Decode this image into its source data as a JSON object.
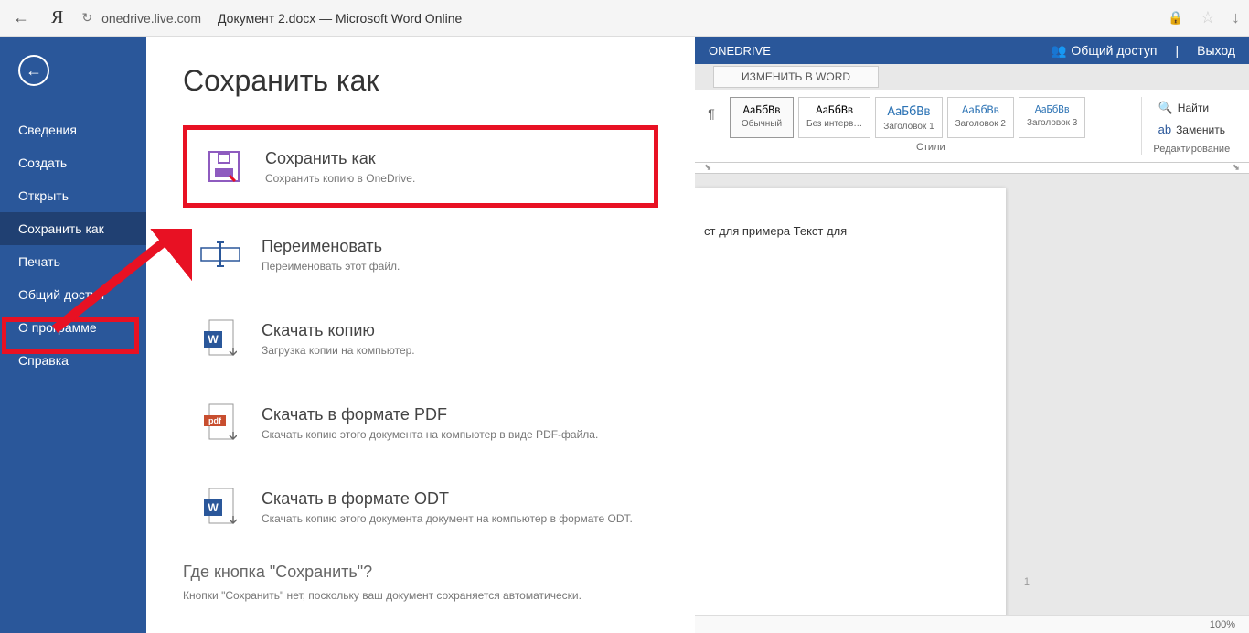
{
  "browser": {
    "url": "onedrive.live.com",
    "title": "Документ 2.docx — Microsoft Word Online"
  },
  "backstage": {
    "title": "Сохранить как",
    "menu": [
      {
        "label": "Сведения"
      },
      {
        "label": "Создать"
      },
      {
        "label": "Открыть"
      },
      {
        "label": "Сохранить как"
      },
      {
        "label": "Печать"
      },
      {
        "label": "Общий доступ"
      },
      {
        "label": "О программе"
      },
      {
        "label": "Справка"
      }
    ],
    "options": [
      {
        "title": "Сохранить как",
        "desc": "Сохранить копию в OneDrive."
      },
      {
        "title": "Переименовать",
        "desc": "Переименовать этот файл."
      },
      {
        "title": "Скачать копию",
        "desc": "Загрузка копии на компьютер."
      },
      {
        "title": "Скачать в формате PDF",
        "desc": "Скачать копию этого документа на компьютер в виде PDF-файла."
      },
      {
        "title": "Скачать в формате ODT",
        "desc": "Скачать копию этого документа документ на компьютер в формате ODT."
      }
    ],
    "where_title": "Где кнопка \"Сохранить\"?",
    "where_desc": "Кнопки \"Сохранить\" нет, поскольку ваш документ сохраняется автоматически."
  },
  "word": {
    "onedrive_label": "ONEDRIVE",
    "share_label": "Общий доступ",
    "logout_label": "Выход",
    "edit_in_word": "ИЗМЕНИТЬ В WORD",
    "styles": [
      {
        "preview": "АаБбВв",
        "name": "Обычный"
      },
      {
        "preview": "АаБбВв",
        "name": "Без интерв…"
      },
      {
        "preview": "АаБбВв",
        "name": "Заголовок 1"
      },
      {
        "preview": "АаБбВв",
        "name": "Заголовок 2"
      },
      {
        "preview": "АаБбВв",
        "name": "Заголовок 3"
      }
    ],
    "styles_label": "Стили",
    "find_label": "Найти",
    "replace_label": "Заменить",
    "editing_label": "Редактирование",
    "doc_text": "ст для примера Текст для",
    "page_num": "1",
    "zoom": "100%"
  }
}
